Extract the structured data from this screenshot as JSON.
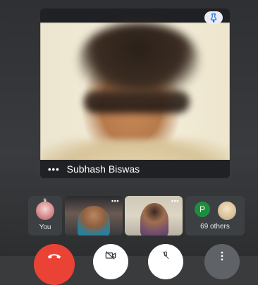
{
  "main_speaker": {
    "name": "Subhash Biswas",
    "more_label": "•••",
    "pin_icon": "pin-icon"
  },
  "participants": {
    "you_label": "You",
    "tile_more_label": "•••",
    "others_avatar_letter": "P",
    "others_label": "69 others"
  },
  "controls": {
    "end_call_icon": "phone-hangup-icon",
    "camera_icon": "camera-off-icon",
    "mic_icon": "mic-off-icon",
    "more_icon": "more-vert-icon"
  },
  "colors": {
    "background": "#3a3b3d",
    "end_call": "#ea4335",
    "avatar_green": "#1e8e3e",
    "pin_blue": "#1a73e8"
  }
}
